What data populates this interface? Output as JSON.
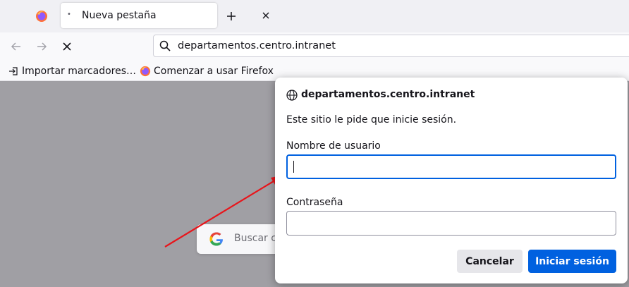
{
  "tab": {
    "title": "Nueva pestaña",
    "dot": "•"
  },
  "urlbar": {
    "value": "departamentos.centro.intranet"
  },
  "bookmarks": [
    {
      "label": "Importar marcadores…",
      "icon": "import-icon"
    },
    {
      "label": "Comenzar a usar Firefox",
      "icon": "firefox-icon"
    }
  ],
  "google_search": {
    "placeholder": "Buscar co"
  },
  "dialog": {
    "host": "departamentos.centro.intranet",
    "message": "Este sitio le pide que inicie sesión.",
    "username_label": "Nombre de usuario",
    "username_value": "",
    "password_label": "Contraseña",
    "password_value": "",
    "cancel_label": "Cancelar",
    "login_label": "Iniciar sesión"
  },
  "colors": {
    "accent": "#0061e0",
    "annotation_arrow": "#e8151b"
  }
}
